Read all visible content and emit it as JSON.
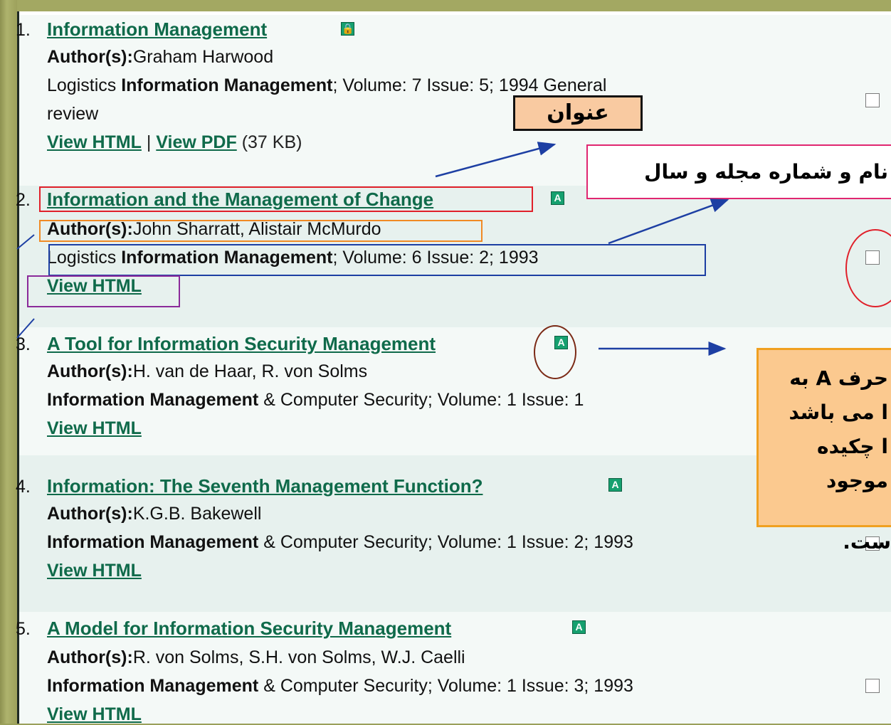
{
  "results": [
    {
      "number": "1.",
      "title": "Information Management",
      "badge": "lock",
      "authors_label": "Author(s):",
      "authors": "Graham Harwood",
      "source_prefix": "Logistics ",
      "source_bold": "Information Management",
      "source_rest": "; Volume: 7   Issue: 5; 1994 General",
      "source_cont": "review",
      "links": {
        "html": "View HTML",
        "sep": " | ",
        "pdf": "View PDF",
        "size": "(37 KB)"
      }
    },
    {
      "number": "2.",
      "title": "Information and the Management of Change",
      "badge": "A",
      "authors_label": "Author(s):",
      "authors": "John Sharratt, Alistair McMurdo",
      "source_prefix": "Logistics ",
      "source_bold": "Information Management",
      "source_rest": "; Volume: 6   Issue: 2; 1993",
      "links": {
        "html": "View HTML"
      }
    },
    {
      "number": "3.",
      "title": "A Tool for Information Security Management",
      "badge": "A",
      "authors_label": "Author(s):",
      "authors": "H. van de Haar, R. von Solms",
      "source_bold": "Information Management",
      "source_rest": " & Computer Security; Volume: 1   Issue: 1",
      "links": {
        "html": "View HTML"
      }
    },
    {
      "number": "4.",
      "title": "Information: The Seventh Management Function?",
      "badge": "A",
      "authors_label": "Author(s):",
      "authors": "K.G.B. Bakewell",
      "source_bold": "Information Management",
      "source_rest": " & Computer Security; Volume: 1   Issue: 2; 1993",
      "links": {
        "html": "View HTML"
      }
    },
    {
      "number": "5.",
      "title": "A Model for Information Security Management",
      "badge": "A",
      "authors_label": "Author(s):",
      "authors": "R. von Solms, S.H. von Solms, W.J. Caelli",
      "source_bold": "Information Management",
      "source_rest": " & Computer Security; Volume: 1   Issue: 3; 1993",
      "links": {
        "html": "View HTML"
      }
    }
  ],
  "callouts": {
    "title_label": "عنوان",
    "journal_label": "نام و شماره مجله و سال",
    "abstract_lines": [
      "حرف  A به",
      "ا می باشد",
      "ا چکیده",
      "موجود"
    ],
    "abstract_tail": "ست."
  },
  "colors": {
    "link": "#0f6a4a",
    "badge": "#16a06f",
    "title_box": "#e0202a",
    "author_box": "#f08a24",
    "source_box": "#1d3fa3",
    "view_box": "#8b2a9a",
    "callout_fill": "#f9caa1",
    "abstract_fill": "#fbc98f",
    "arrow": "#1d3fa3"
  }
}
